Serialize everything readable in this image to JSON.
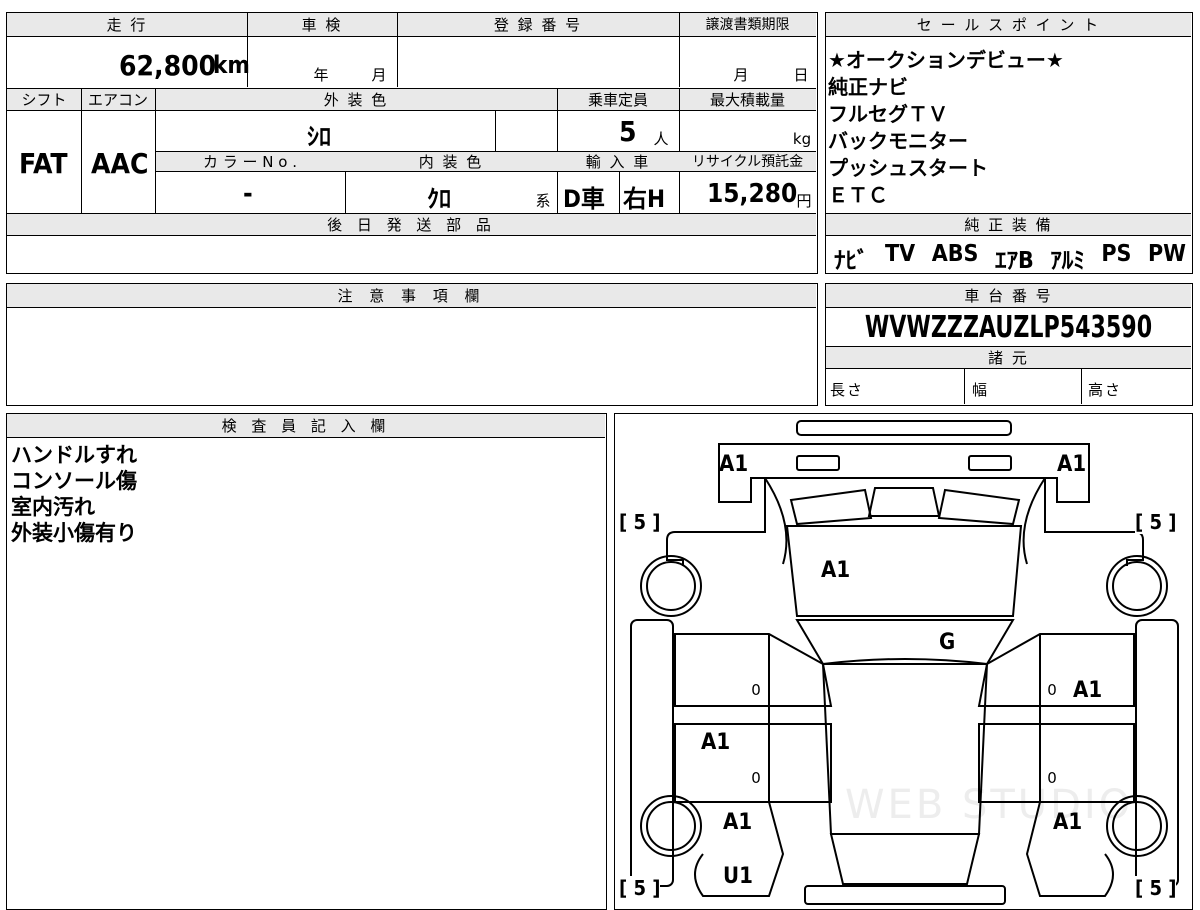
{
  "top": {
    "mileage_label": "走 行",
    "mileage_value": "62,800",
    "mileage_unit": "km",
    "shaken_label": "車 検",
    "shaken_year": "年",
    "shaken_month": "月",
    "reg_label": "登 録 番 号",
    "transfer_label": "譲渡書類期限",
    "transfer_month": "月",
    "transfer_day": "日",
    "shift_label": "シフト",
    "shift_value": "FAT",
    "aircon_label": "エアコン",
    "aircon_value": "AAC",
    "exterior_label": "外 装 色",
    "exterior_value": "ｼﾛ",
    "capacity_label": "乗車定員",
    "capacity_value": "5",
    "capacity_unit": "人",
    "maxload_label": "最大積載量",
    "maxload_unit": "kg",
    "colorno_label": "カ ラ ー  N o .",
    "colorno_value": "-",
    "interior_label": "内 装 色",
    "interior_value": "ｸﾛ",
    "interior_unit": "系",
    "import_label": "輸 入 車",
    "import_d": "D車",
    "import_h": "右H",
    "recycle_label": "リサイクル預託金",
    "recycle_value": "15,280",
    "recycle_unit": "円",
    "later_label": "後 日 発 送 部 品"
  },
  "sales": {
    "label": "セ ー ル ス ポ イ ン ト",
    "lines": [
      "★オークションデビュー★",
      "純正ナビ",
      "フルセグＴＶ",
      "バックモニター",
      "プッシュスタート",
      "ＥＴＣ"
    ]
  },
  "equipment": {
    "label": "純 正 装 備",
    "items": [
      "ﾅﾋﾞ",
      "TV",
      "ABS",
      "ｴｱB",
      "ｱﾙﾐ",
      "PS",
      "PW"
    ]
  },
  "caution": {
    "label": "注 意 事 項 欄"
  },
  "chassis": {
    "label": "車 台 番 号",
    "number": "WVWZZZAUZLP543590",
    "specs_label": "諸 元",
    "length_label": "長さ",
    "width_label": "幅",
    "height_label": "高さ"
  },
  "inspector": {
    "label": "検 査 員 記 入 欄",
    "lines": [
      "ハンドルすれ",
      "コンソール傷",
      "室内汚れ",
      "外装小傷有り"
    ]
  },
  "diagram": {
    "marks": {
      "front_left": "A1",
      "front_right": "A1",
      "hood": "A1",
      "windshield": "G",
      "left_front_door": "A1",
      "right_front_door": "A1",
      "left_rear_fender": "A1",
      "right_rear_fender": "A1",
      "rear_left_lower": "U1",
      "door_zero_1": "0",
      "door_zero_2": "0",
      "door_zero_3": "0",
      "door_zero_4": "0",
      "tire_fl": "[ 5 ]",
      "tire_fr": "[ 5 ]",
      "tire_rl": "[ 5 ]",
      "tire_rr": "[ 5 ]"
    },
    "watermark": "WEB STUDIO"
  }
}
